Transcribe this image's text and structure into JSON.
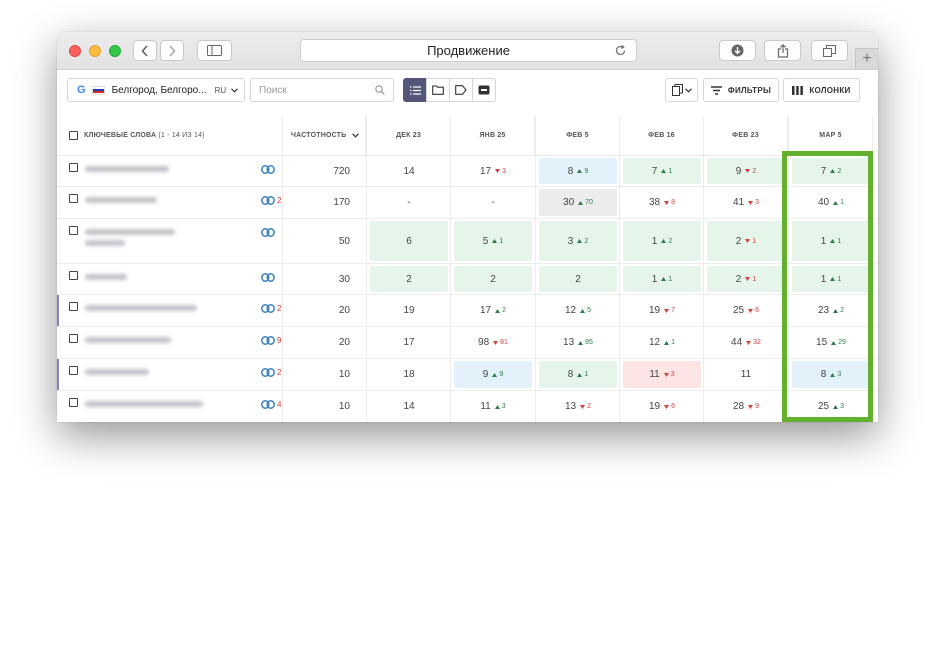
{
  "window": {
    "title": "Продвижение"
  },
  "toolbar": {
    "region_label": "Белгород, Белгоро...",
    "region_lang": "RU",
    "search_placeholder": "Поиск",
    "filters_label": "ФИЛЬТРЫ",
    "columns_label": "КОЛОНКИ"
  },
  "table": {
    "keywords_header": "КЛЮЧЕВЫЕ СЛОВА",
    "keywords_count": "(1 - 14 ИЗ 14)",
    "frequency_header": "ЧАСТОТНОСТЬ",
    "dates": [
      "ДЕК 23",
      "ЯНВ 25",
      "ФЕВ 5",
      "ФЕВ 16",
      "ФЕВ 23",
      "МАР 5"
    ],
    "rows": [
      {
        "links": "",
        "freq": "720",
        "cells": [
          {
            "v": "14",
            "d": "",
            "dir": "",
            "bg": ""
          },
          {
            "v": "17",
            "d": "3",
            "dir": "down",
            "bg": ""
          },
          {
            "v": "8",
            "d": "9",
            "dir": "up",
            "bg": "blue"
          },
          {
            "v": "7",
            "d": "1",
            "dir": "up",
            "bg": "green"
          },
          {
            "v": "9",
            "d": "2",
            "dir": "down",
            "bg": "green"
          },
          {
            "v": "7",
            "d": "2",
            "dir": "up",
            "bg": "green"
          }
        ]
      },
      {
        "links": "2",
        "freq": "170",
        "cells": [
          {
            "v": "-",
            "d": "",
            "dir": "",
            "bg": ""
          },
          {
            "v": "-",
            "d": "",
            "dir": "",
            "bg": ""
          },
          {
            "v": "30",
            "d": "70",
            "dir": "up",
            "bg": "grey"
          },
          {
            "v": "38",
            "d": "8",
            "dir": "down",
            "bg": ""
          },
          {
            "v": "41",
            "d": "3",
            "dir": "down",
            "bg": ""
          },
          {
            "v": "40",
            "d": "1",
            "dir": "up",
            "bg": ""
          }
        ]
      },
      {
        "links": "",
        "freq": "50",
        "cells": [
          {
            "v": "6",
            "d": "",
            "dir": "",
            "bg": "green"
          },
          {
            "v": "5",
            "d": "1",
            "dir": "up",
            "bg": "green"
          },
          {
            "v": "3",
            "d": "2",
            "dir": "up",
            "bg": "green"
          },
          {
            "v": "1",
            "d": "2",
            "dir": "up",
            "bg": "green"
          },
          {
            "v": "2",
            "d": "1",
            "dir": "down",
            "bg": "green"
          },
          {
            "v": "1",
            "d": "1",
            "dir": "up",
            "bg": "green"
          }
        ]
      },
      {
        "links": "",
        "freq": "30",
        "cells": [
          {
            "v": "2",
            "d": "",
            "dir": "",
            "bg": "green"
          },
          {
            "v": "2",
            "d": "",
            "dir": "",
            "bg": "green"
          },
          {
            "v": "2",
            "d": "",
            "dir": "",
            "bg": "green"
          },
          {
            "v": "1",
            "d": "1",
            "dir": "up",
            "bg": "green"
          },
          {
            "v": "2",
            "d": "1",
            "dir": "down",
            "bg": "green"
          },
          {
            "v": "1",
            "d": "1",
            "dir": "up",
            "bg": "green"
          }
        ]
      },
      {
        "links": "2",
        "freq": "20",
        "cells": [
          {
            "v": "19",
            "d": "",
            "dir": "",
            "bg": ""
          },
          {
            "v": "17",
            "d": "2",
            "dir": "up",
            "bg": ""
          },
          {
            "v": "12",
            "d": "5",
            "dir": "up",
            "bg": ""
          },
          {
            "v": "19",
            "d": "7",
            "dir": "down",
            "bg": ""
          },
          {
            "v": "25",
            "d": "6",
            "dir": "down",
            "bg": ""
          },
          {
            "v": "23",
            "d": "2",
            "dir": "up",
            "bg": ""
          }
        ]
      },
      {
        "links": "9",
        "freq": "20",
        "cells": [
          {
            "v": "17",
            "d": "",
            "dir": "",
            "bg": ""
          },
          {
            "v": "98",
            "d": "81",
            "dir": "down",
            "bg": ""
          },
          {
            "v": "13",
            "d": "85",
            "dir": "up",
            "bg": ""
          },
          {
            "v": "12",
            "d": "1",
            "dir": "up",
            "bg": ""
          },
          {
            "v": "44",
            "d": "32",
            "dir": "down",
            "bg": ""
          },
          {
            "v": "15",
            "d": "29",
            "dir": "up",
            "bg": ""
          }
        ]
      },
      {
        "links": "2",
        "freq": "10",
        "cells": [
          {
            "v": "18",
            "d": "",
            "dir": "",
            "bg": ""
          },
          {
            "v": "9",
            "d": "9",
            "dir": "up",
            "bg": "blue"
          },
          {
            "v": "8",
            "d": "1",
            "dir": "up",
            "bg": "green"
          },
          {
            "v": "11",
            "d": "3",
            "dir": "down",
            "bg": "red"
          },
          {
            "v": "11",
            "d": "",
            "dir": "",
            "bg": ""
          },
          {
            "v": "8",
            "d": "3",
            "dir": "up",
            "bg": "blue"
          }
        ]
      },
      {
        "links": "4",
        "freq": "10",
        "cells": [
          {
            "v": "14",
            "d": "",
            "dir": "",
            "bg": ""
          },
          {
            "v": "11",
            "d": "3",
            "dir": "up",
            "bg": ""
          },
          {
            "v": "13",
            "d": "2",
            "dir": "down",
            "bg": ""
          },
          {
            "v": "19",
            "d": "6",
            "dir": "down",
            "bg": ""
          },
          {
            "v": "28",
            "d": "9",
            "dir": "down",
            "bg": ""
          },
          {
            "v": "25",
            "d": "3",
            "dir": "up",
            "bg": ""
          }
        ]
      }
    ]
  },
  "colors": {
    "highlight": "#63b02e",
    "accent": "#54567a",
    "up": "#2e7d4a",
    "down": "#d44242",
    "link": "#3b82c4"
  }
}
